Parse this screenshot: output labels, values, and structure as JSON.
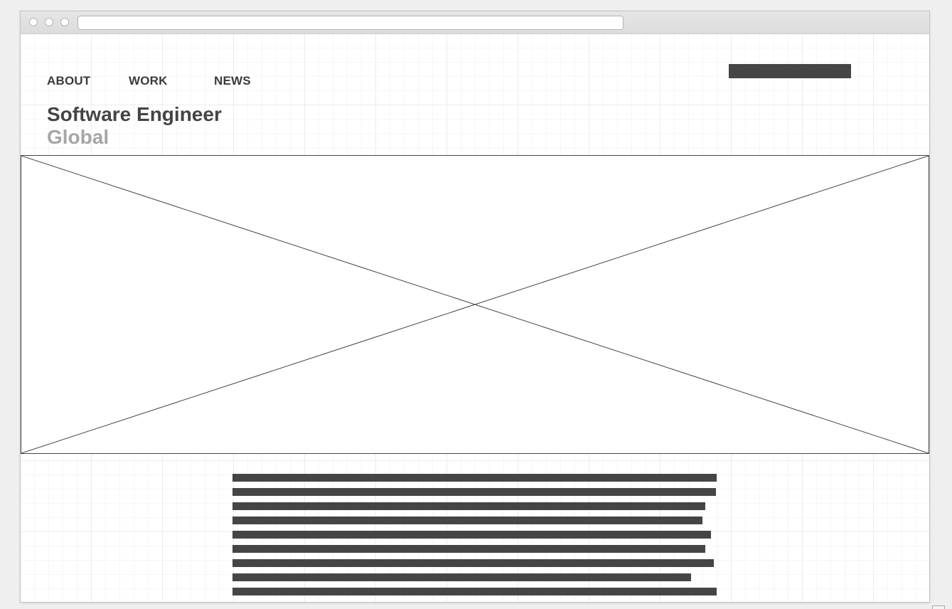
{
  "browser": {
    "url": ""
  },
  "nav": {
    "items": [
      {
        "label": "ABOUT"
      },
      {
        "label": "WORK"
      },
      {
        "label": "NEWS"
      }
    ]
  },
  "header": {
    "title": "Software Engineer",
    "subtitle": "Global"
  },
  "colors": {
    "text_dark": "#444444",
    "text_muted": "#a6a6a6",
    "placeholder_bar": "#454545",
    "background": "#efefef"
  }
}
